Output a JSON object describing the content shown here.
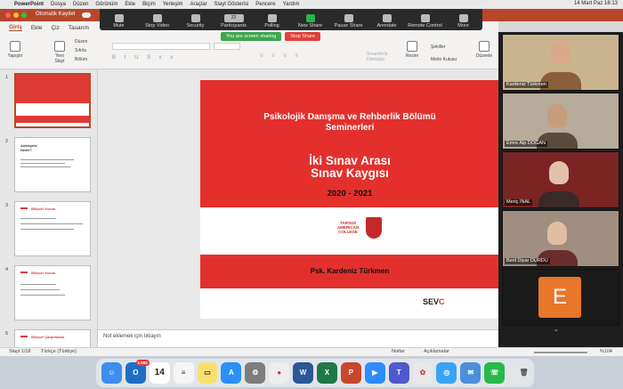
{
  "menubar": {
    "app_name": "PowerPoint",
    "items": [
      "Dosya",
      "Düzen",
      "Görünüm",
      "Ekle",
      "Biçim",
      "Yerleşim",
      "Araçlar",
      "Slayt Gösterisi",
      "Pencere",
      "Yardım"
    ],
    "clock": "14 Mart Paz 16:13"
  },
  "titlebar": {
    "autosave_label": "Otomatik Kaydet"
  },
  "ribbon": {
    "tabs": [
      "Giriş",
      "Ekle",
      "Çiz",
      "Tasarım"
    ],
    "paste_label": "Yapıştır",
    "new_slide_label": "Yeni Slayt",
    "layout_items": [
      "Düzen",
      "Sıfırla",
      "Bölüm"
    ],
    "right_items": [
      "Resim",
      "Şekiller",
      "Metin Kutusu",
      "Düzenle",
      "SmartArt'a Dönüştür"
    ]
  },
  "zoom": {
    "buttons": [
      "Mute",
      "Stop Video",
      "Security",
      "Participants",
      "Polling",
      "New Share",
      "Pause Share",
      "Annotate",
      "Remote Control",
      "More"
    ],
    "participant_count": "22",
    "sharing_text": "You are screen sharing",
    "stop_share_label": "Stop Share"
  },
  "slides": [
    {
      "num": "1",
      "selected": true
    },
    {
      "num": "2",
      "title": "Ankisyete Nedir?"
    },
    {
      "num": "3",
      "title": "Bilişsel Yorum"
    },
    {
      "num": "4",
      "title": "Bilişsel Yorum"
    },
    {
      "num": "5",
      "title": "Bilişsel Çarpıtmalar"
    }
  ],
  "slide": {
    "heading": "Psikolojik Danışma ve Rehberlik Bölümü Seminerleri",
    "title_line1": "İki Sınav Arası",
    "title_line2": "Sınav Kaygısı",
    "years": "2020 - 2021",
    "logo_text": "TARSUS AMERICAN COLLEGE",
    "presenter": "Psk. Kardeniz Türkmen",
    "footer_brand_prefix": "SEV",
    "footer_brand_suffix": "C"
  },
  "notes_placeholder": "Not eklemek için tıklayın",
  "statusbar": {
    "slide_info": "Slayt 1/18",
    "language": "Türkçe (Türkiye)",
    "notes_label": "Notlar",
    "comments_label": "Açıklamalar",
    "zoom_level": "%104"
  },
  "participants": [
    {
      "name": "Kardeniz Türkmen",
      "color": "#8a5e3b"
    },
    {
      "name": "Emre Alp DOĞAN",
      "color": "#5a4a3a"
    },
    {
      "name": "Meriç İNAL",
      "color": "#3a2a2a"
    },
    {
      "name": "Beril Diyar DURDU",
      "color": "#6b2d2b"
    },
    {
      "name": "",
      "avatar_letter": "E"
    }
  ],
  "dock": {
    "calendar_day": "14",
    "outlook_badge": "1.682",
    "apps": [
      "Finder",
      "Outlook",
      "Calendar",
      "Reminders",
      "Notes",
      "App Store",
      "System Preferences",
      "Chrome",
      "Word",
      "Excel",
      "PowerPoint",
      "Zoom",
      "Teams",
      "Launchpad",
      "Safari",
      "Mail",
      "WhatsApp",
      "Trash"
    ]
  }
}
